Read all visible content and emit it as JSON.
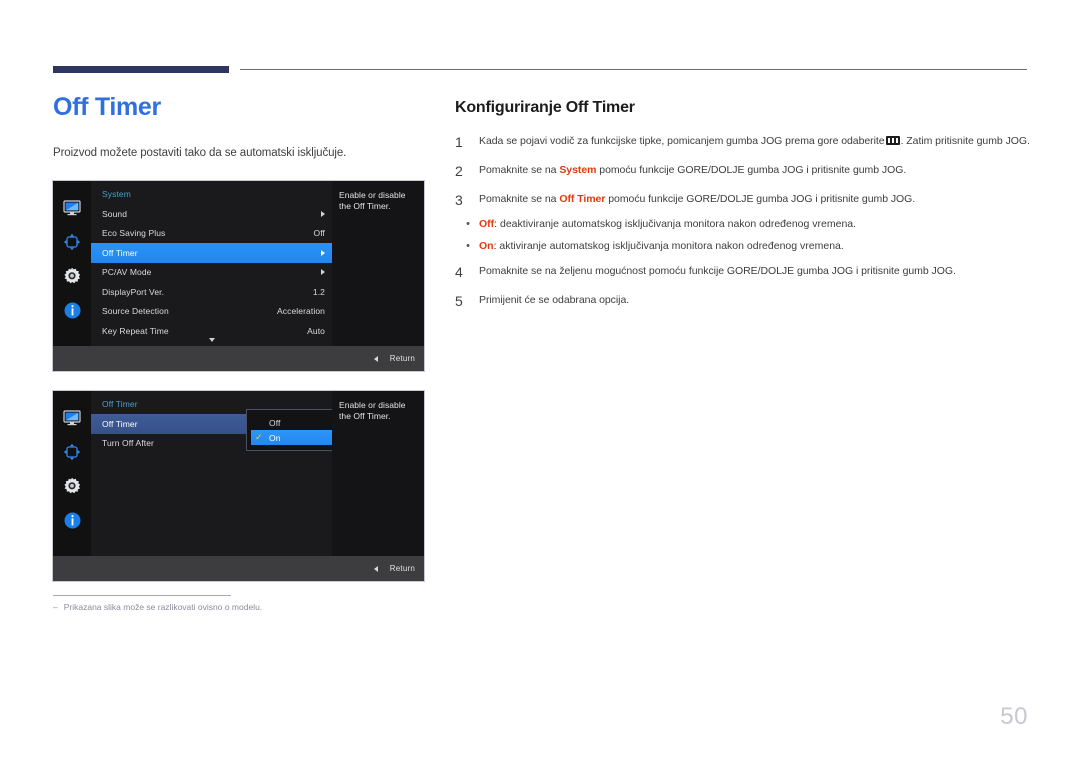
{
  "page": {
    "title": "Off Timer",
    "intro": "Proizvod možete postaviti tako da se automatski isključuje.",
    "number": "50",
    "footnote_dash": "–",
    "footnote": "Prikazana slika može se razlikovati ovisno o modelu."
  },
  "section": {
    "title": "Konfiguriranje Off Timer",
    "steps": [
      {
        "num": "1",
        "text_before": "Kada se pojavi vodič za funkcijske tipke, pomicanjem gumba JOG prema gore odaberite",
        "icon": "menu-glyph",
        "text_after": ". Zatim pritisnite gumb JOG."
      },
      {
        "num": "2",
        "text_before": "Pomaknite se na",
        "highlight": "System",
        "text_after": "pomoću funkcije GORE/DOLJE gumba JOG i pritisnite gumb JOG."
      },
      {
        "num": "3",
        "text_before": "Pomaknite se na",
        "highlight": "Off Timer",
        "text_after": "pomoću funkcije GORE/DOLJE gumba JOG i pritisnite gumb JOG."
      },
      {
        "num": "4",
        "text_before": "Pomaknite se na željenu mogućnost pomoću funkcije GORE/DOLJE gumba JOG i pritisnite gumb JOG.",
        "highlight": "",
        "text_after": ""
      },
      {
        "num": "5",
        "text_before": "Primijenit će se odabrana opcija.",
        "highlight": "",
        "text_after": ""
      }
    ],
    "bullets": [
      {
        "dot": "•",
        "highlight": "Off",
        "text": ": deaktiviranje automatskog isključivanja monitora nakon određenog vremena."
      },
      {
        "dot": "•",
        "highlight": "On",
        "text": ": aktiviranje automatskog isključivanja monitora nakon određenog vremena."
      }
    ]
  },
  "osd1": {
    "sidebar_icons": [
      "monitor-icon",
      "move-arrows-icon",
      "gear-icon",
      "info-icon"
    ],
    "menu_title": "System",
    "rows": [
      {
        "label": "Sound",
        "value": "",
        "arrow": true,
        "selected": false
      },
      {
        "label": "Eco Saving Plus",
        "value": "Off",
        "arrow": false,
        "selected": false
      },
      {
        "label": "Off Timer",
        "value": "",
        "arrow": true,
        "selected": true
      },
      {
        "label": "PC/AV Mode",
        "value": "",
        "arrow": true,
        "selected": false
      },
      {
        "label": "DisplayPort Ver.",
        "value": "1.2",
        "arrow": false,
        "selected": false
      },
      {
        "label": "Source Detection",
        "value": "Acceleration",
        "arrow": false,
        "selected": false
      },
      {
        "label": "Key Repeat Time",
        "value": "Auto",
        "arrow": false,
        "selected": false
      }
    ],
    "info_line1": "Enable or disable",
    "info_line2": "the Off Timer.",
    "return_label": "Return"
  },
  "osd2": {
    "sidebar_icons": [
      "monitor-icon",
      "move-arrows-icon",
      "gear-icon",
      "info-icon"
    ],
    "menu_title": "Off Timer",
    "rows": [
      {
        "label": "Off Timer",
        "selected_dim": true
      },
      {
        "label": "Turn Off After",
        "selected_dim": false
      }
    ],
    "popup": {
      "options": [
        {
          "label": "Off",
          "checked": false,
          "selected": false
        },
        {
          "label": "On",
          "checked": true,
          "selected": true
        }
      ],
      "check_glyph": "✓"
    },
    "info_line1": "Enable or disable",
    "info_line2": "the Off Timer.",
    "return_label": "Return"
  },
  "colors": {
    "accent_blue": "#2f6fe0",
    "rule_navy": "#2e3560",
    "highlight_red": "#e8380d",
    "osd_select_blue": "#2b93f7",
    "osd_select_dim": "#3f5c96",
    "osd_title_teal": "#4c9ec9",
    "check_yellow": "#d8e400"
  }
}
